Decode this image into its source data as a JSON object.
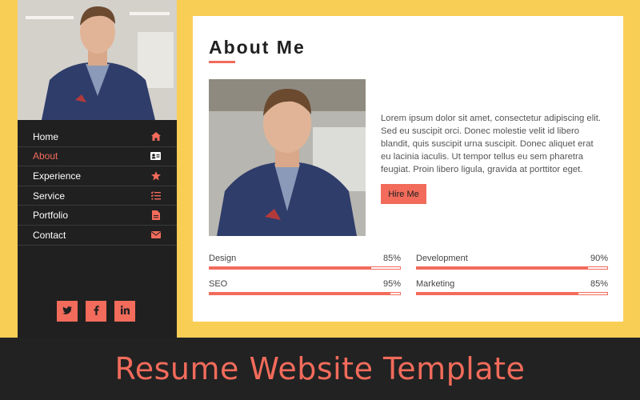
{
  "nav": {
    "items": [
      {
        "label": "Home",
        "icon": "home-icon"
      },
      {
        "label": "About",
        "icon": "id-card-icon",
        "active": true
      },
      {
        "label": "Experience",
        "icon": "star-icon"
      },
      {
        "label": "Service",
        "icon": "list-check-icon"
      },
      {
        "label": "Portfolio",
        "icon": "file-icon"
      },
      {
        "label": "Contact",
        "icon": "envelope-icon"
      }
    ]
  },
  "socials": {
    "twitter": "t",
    "facebook": "f",
    "linkedin": "in"
  },
  "about": {
    "title": "About Me",
    "bio": "Lorem ipsum dolor sit amet, consectetur adipiscing elit. Sed eu suscipit orci. Donec molestie velit id libero blandit, quis suscipit urna suscipit. Donec aliquet erat eu lacinia iaculis. Ut tempor tellus eu sem pharetra feugiat. Proin libero ligula, gravida at porttitor eget.",
    "hire_label": "Hire Me"
  },
  "skills": [
    {
      "name": "Design",
      "percent_label": "85%",
      "value": 0.85
    },
    {
      "name": "Development",
      "percent_label": "90%",
      "value": 0.9
    },
    {
      "name": "SEO",
      "percent_label": "95%",
      "value": 0.95
    },
    {
      "name": "Marketing",
      "percent_label": "85%",
      "value": 0.85
    }
  ],
  "footer": {
    "title": "Resume Website Template"
  },
  "colors": {
    "accent": "#f26b5b",
    "background": "#f9ce55",
    "sidebar": "#202020"
  }
}
